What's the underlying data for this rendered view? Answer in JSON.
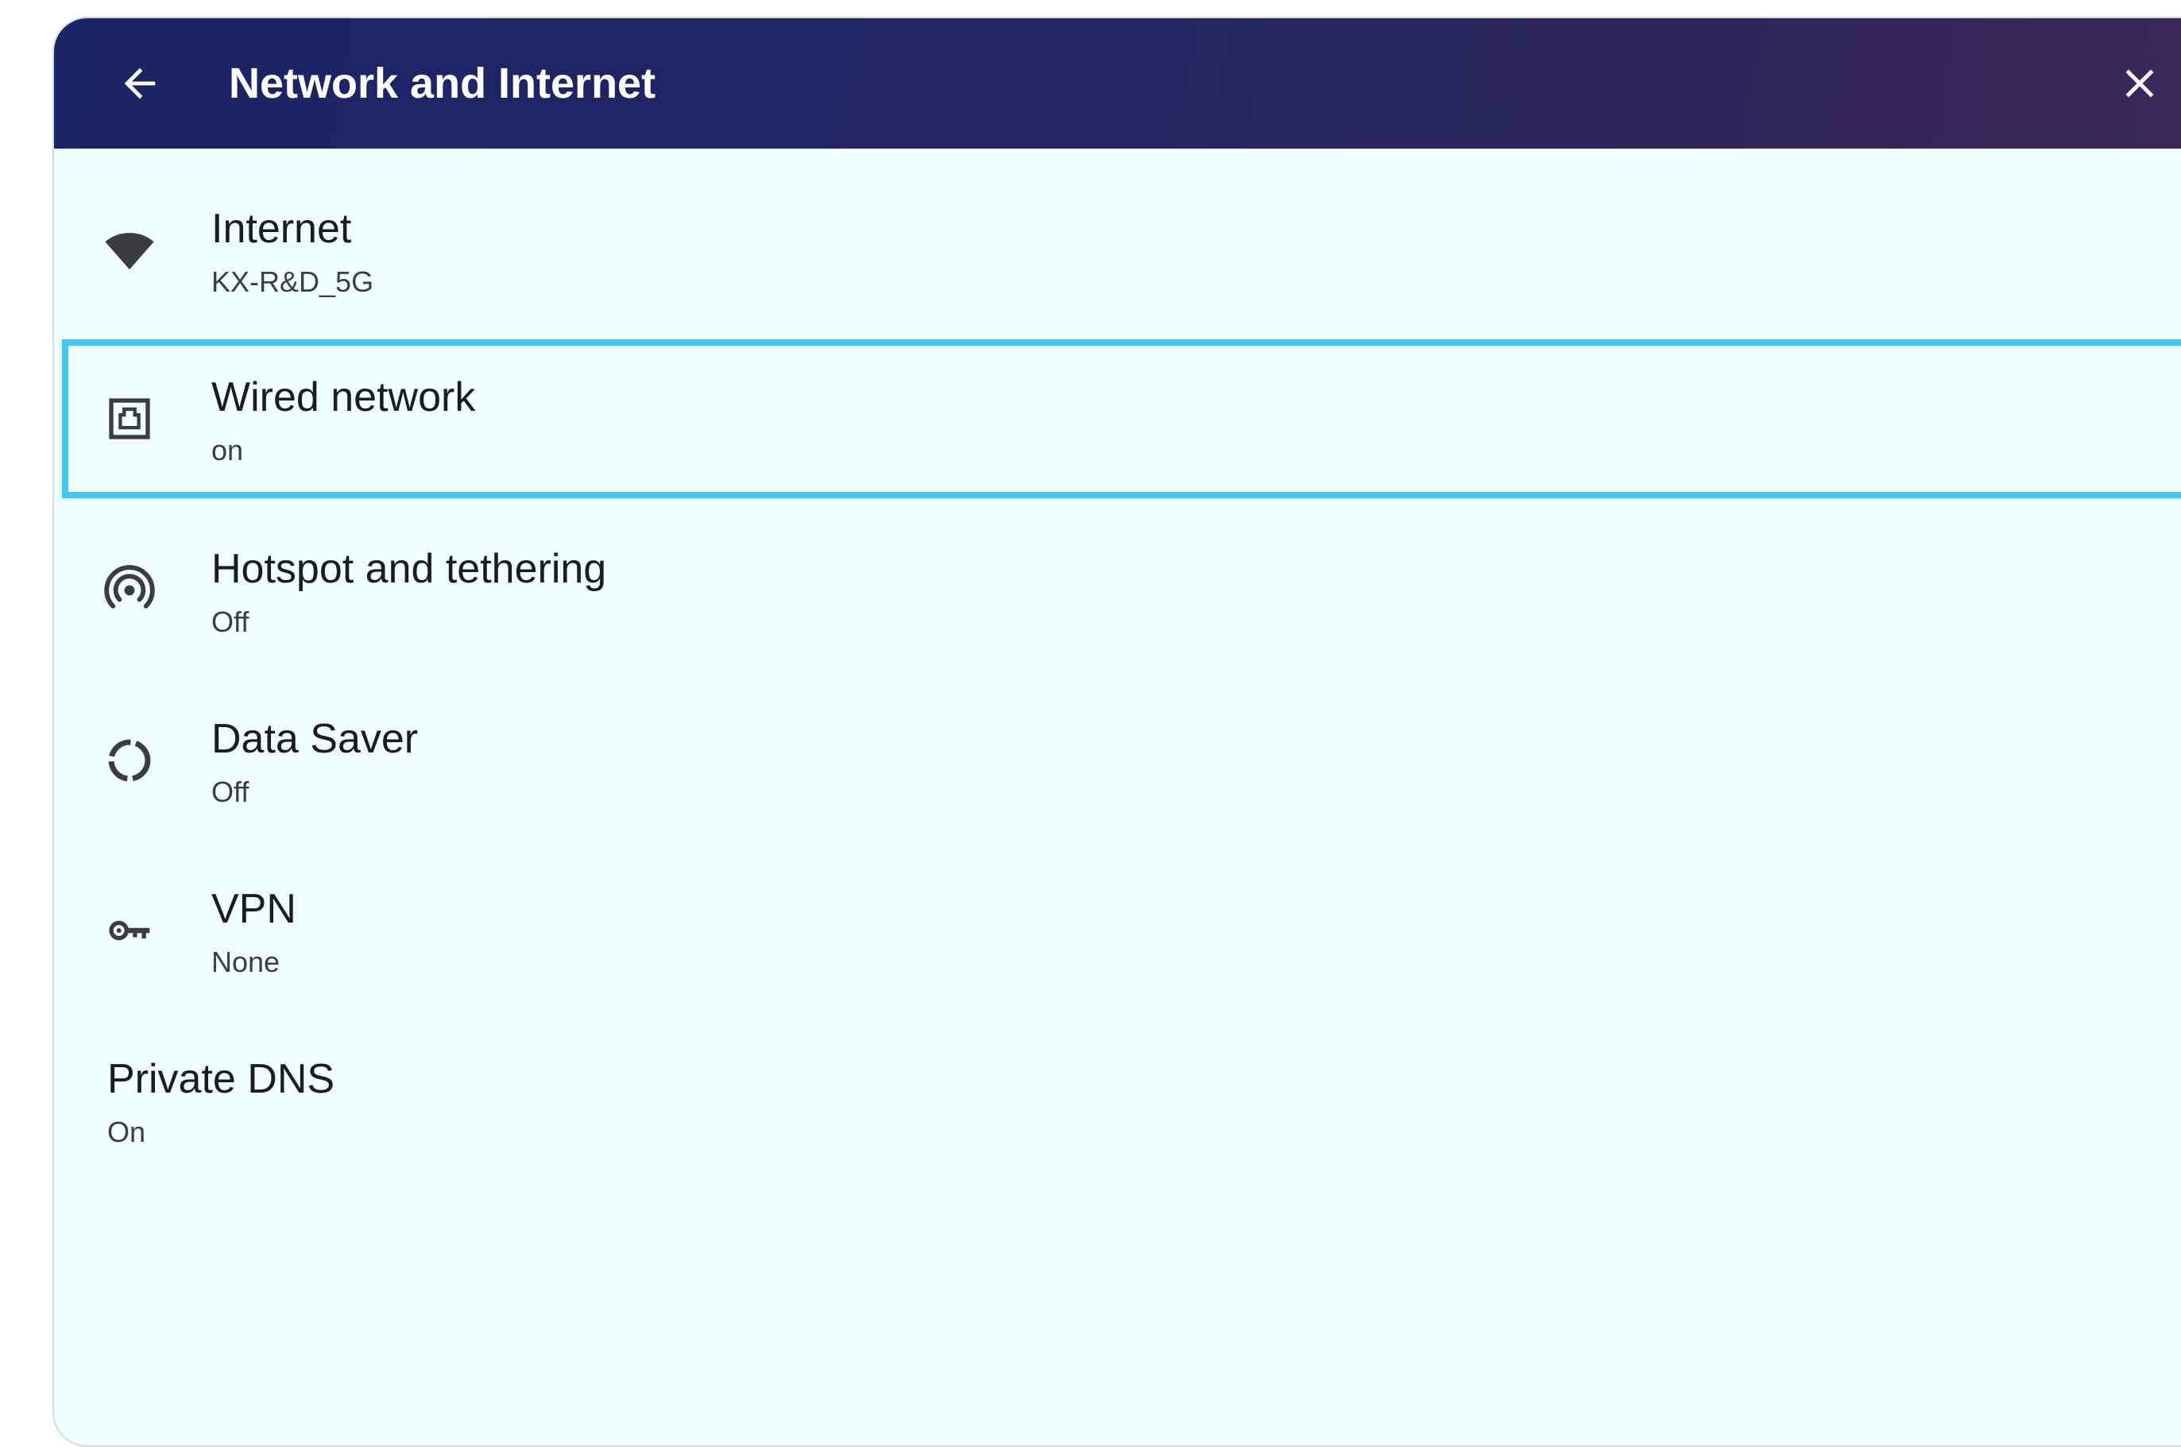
{
  "header": {
    "title": "Network and Internet",
    "back_icon": "arrow-left-icon",
    "close_icon": "close-icon",
    "gradient_colors": [
      "#1b2466",
      "#3a2a58"
    ]
  },
  "items": [
    {
      "id": "internet",
      "title": "Internet",
      "subtitle": "KX-R&D_5G",
      "icon": "wifi-icon"
    },
    {
      "id": "wired",
      "title": "Wired network",
      "subtitle": "on",
      "icon": "ethernet-icon",
      "selected": true
    },
    {
      "id": "hotspot",
      "title": "Hotspot and tethering",
      "subtitle": "Off",
      "icon": "hotspot-icon"
    },
    {
      "id": "datasaver",
      "title": "Data Saver",
      "subtitle": "Off",
      "icon": "data-saver-icon"
    },
    {
      "id": "vpn",
      "title": "VPN",
      "subtitle": "None",
      "icon": "vpn-key-icon"
    },
    {
      "id": "dns",
      "title": "Private DNS",
      "subtitle": "On"
    }
  ],
  "colors": {
    "background": "#f0fefe",
    "selection_border": "#3fc9ef",
    "text_primary": "#1b1c1e",
    "icon": "#3a3c3f"
  }
}
